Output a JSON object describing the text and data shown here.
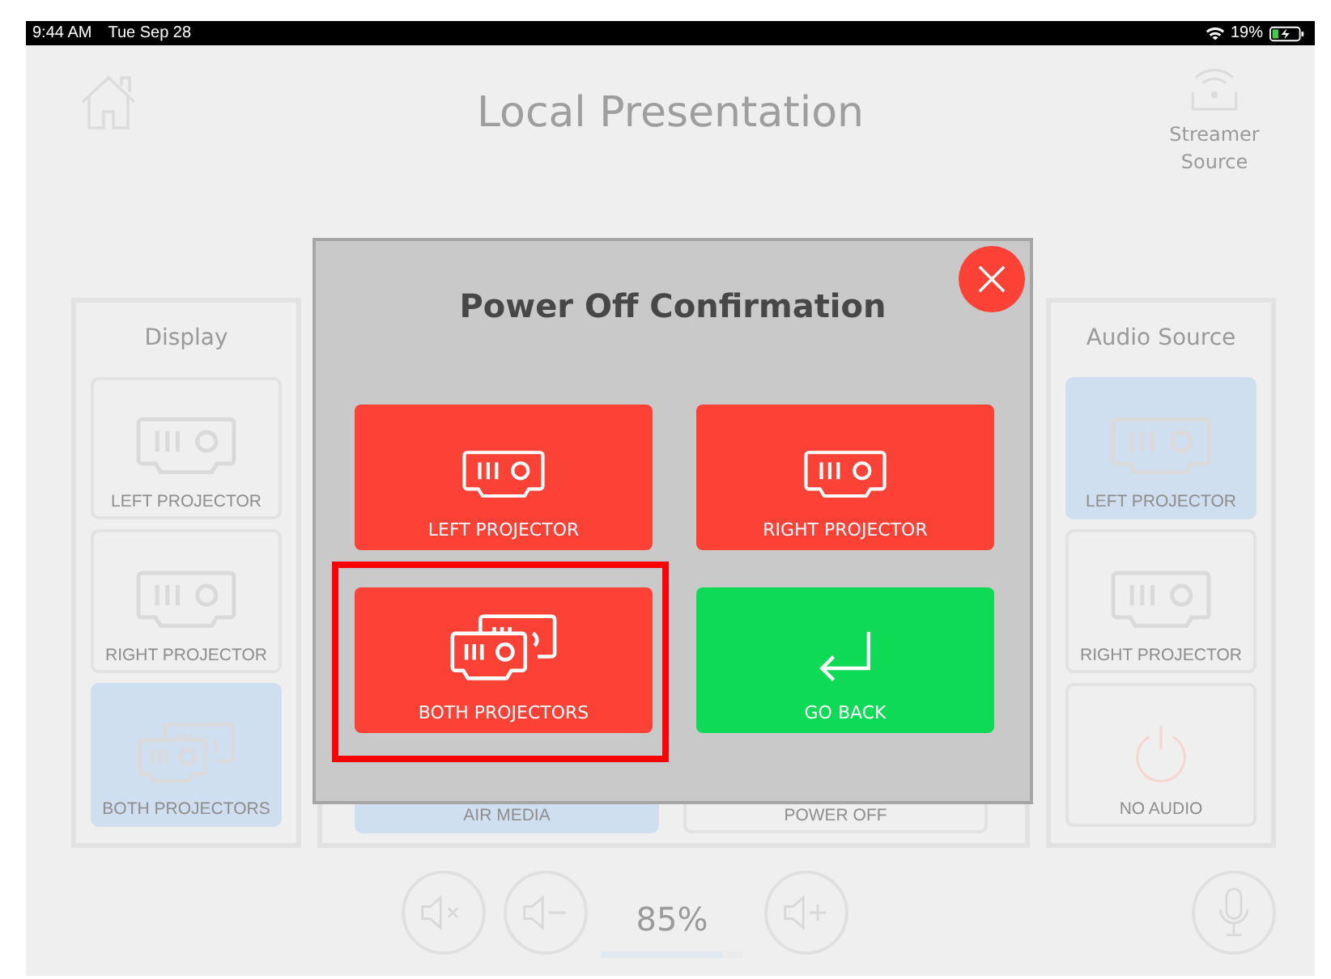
{
  "status_bar": {
    "time": "9:44 AM",
    "date": "Tue Sep 28",
    "battery": "19%"
  },
  "header": {
    "title": "Local Presentation",
    "streamer_label": "Streamer Source"
  },
  "display": {
    "title": "Display",
    "items": [
      {
        "label": "LEFT PROJECTOR",
        "kind": "projector",
        "selected": false
      },
      {
        "label": "RIGHT PROJECTOR",
        "kind": "projector",
        "selected": false
      },
      {
        "label": "BOTH PROJECTORS",
        "kind": "projectors",
        "selected": true
      }
    ]
  },
  "video_source": {
    "items": [
      {
        "label": "AIR MEDIA",
        "selected": true
      },
      {
        "label": "POWER OFF",
        "selected": false
      }
    ]
  },
  "audio_source": {
    "title": "Audio Source",
    "items": [
      {
        "label": "LEFT PROJECTOR",
        "kind": "projector",
        "selected": true
      },
      {
        "label": "RIGHT PROJECTOR",
        "kind": "projector",
        "selected": false
      },
      {
        "label": "NO AUDIO",
        "kind": "power",
        "selected": false
      }
    ]
  },
  "volume": {
    "reading": "85%",
    "level": 0.85
  },
  "dialog": {
    "title": "Power Off Confirmation",
    "buttons": [
      {
        "label": "LEFT PROJECTOR",
        "kind": "projector",
        "color": "#fc4237",
        "highlighted": false
      },
      {
        "label": "RIGHT PROJECTOR",
        "kind": "projector",
        "color": "#fc4237",
        "highlighted": false
      },
      {
        "label": "BOTH PROJECTORS",
        "kind": "projectors",
        "color": "#fc4237",
        "highlighted": true
      },
      {
        "label": "GO BACK",
        "kind": "back",
        "color": "#0fda55",
        "highlighted": false
      }
    ]
  }
}
